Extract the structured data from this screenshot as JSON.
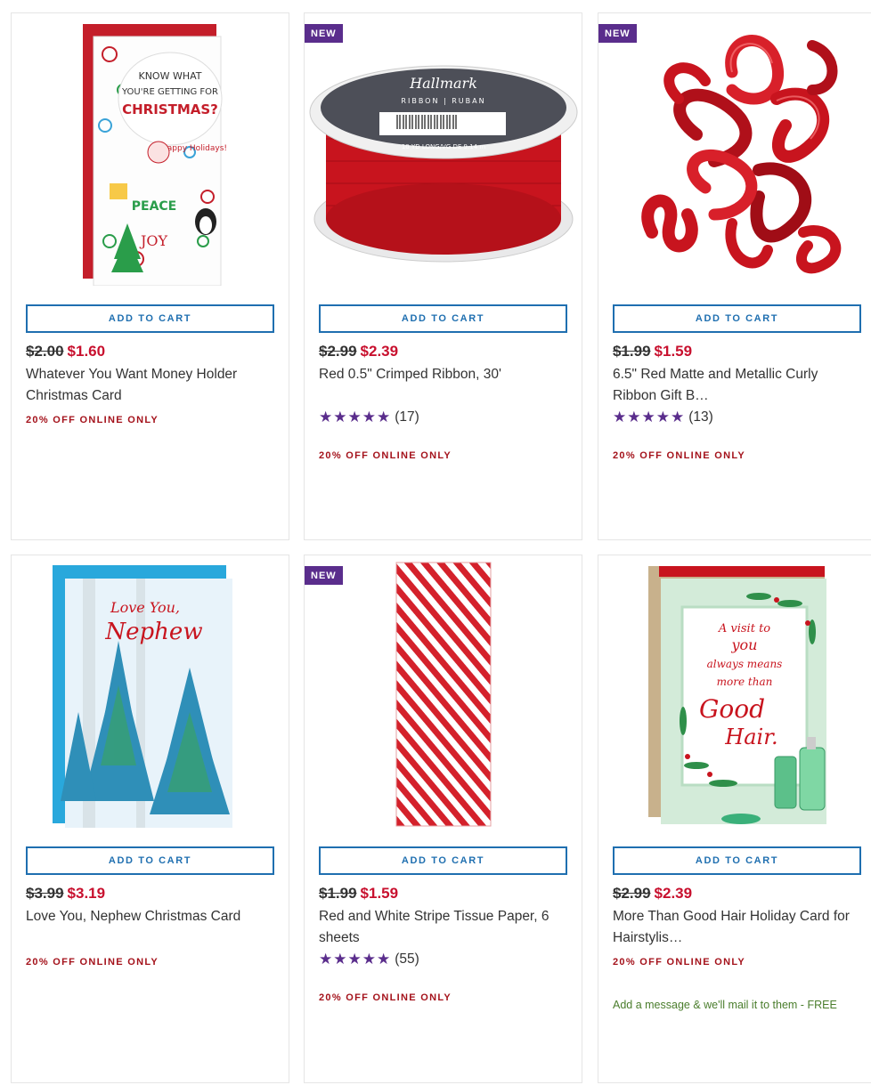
{
  "products": [
    {
      "image": "money-holder-card-image",
      "add_to_cart": "ADD TO CART",
      "price_old": "$2.00",
      "price_new": "$1.60",
      "title": "Whatever You Want Money Holder Christmas Card",
      "promo": "20% OFF ONLINE ONLY",
      "card_text": [
        "KNOW WHAT",
        "YOU'RE GETTING FOR",
        "CHRISTMAS?",
        "PEACE",
        "JOY",
        "Happy Holidays!"
      ]
    },
    {
      "badge": "NEW",
      "image": "red-ribbon-spool-image",
      "add_to_cart": "ADD TO CART",
      "price_old": "$2.99",
      "price_new": "$2.39",
      "title": "Red 0.5\" Crimped Ribbon, 30'",
      "stars": "★★★★★",
      "rating": 5,
      "review_count": "(17)",
      "promo": "20% OFF ONLINE ONLY",
      "spool_text": [
        "Hallmark",
        "RIBBON | RUBAN",
        "10 YD LONG/VG DE 9.14 m"
      ]
    },
    {
      "badge": "NEW",
      "image": "red-curly-bow-image",
      "add_to_cart": "ADD TO CART",
      "price_old": "$1.99",
      "price_new": "$1.59",
      "title": "6.5\" Red Matte and Metallic Curly Ribbon Gift B…",
      "stars": "★★★★★",
      "rating": 5,
      "review_count": "(13)",
      "promo": "20% OFF ONLINE ONLY"
    },
    {
      "image": "nephew-card-image",
      "add_to_cart": "ADD TO CART",
      "price_old": "$3.99",
      "price_new": "$3.19",
      "title": "Love You, Nephew Christmas Card",
      "promo": "20% OFF ONLINE ONLY",
      "card_text": [
        "Love You,",
        "Nephew"
      ]
    },
    {
      "badge": "NEW",
      "image": "striped-tissue-paper-image",
      "add_to_cart": "ADD TO CART",
      "price_old": "$1.99",
      "price_new": "$1.59",
      "title": "Red and White Stripe Tissue Paper, 6 sheets",
      "stars": "★★★★★",
      "rating": 5,
      "review_count": "(55)",
      "promo": "20% OFF ONLINE ONLY"
    },
    {
      "image": "good-hair-card-image",
      "add_to_cart": "ADD TO CART",
      "price_old": "$2.99",
      "price_new": "$2.39",
      "title": "More Than Good Hair Holiday Card for Hairstylis…",
      "promo": "20% OFF ONLINE ONLY",
      "mail_note": "Add a message & we'll mail it to them - FREE",
      "card_text": [
        "A visit to",
        "you",
        "always means",
        "more than",
        "Good",
        "Hair."
      ]
    }
  ],
  "colors": {
    "accent_blue": "#1f6fb0",
    "sale_red": "#c8102e",
    "promo_red": "#a4121b",
    "badge_purple": "#5a2d8c",
    "mail_green": "#4a7d2c"
  }
}
